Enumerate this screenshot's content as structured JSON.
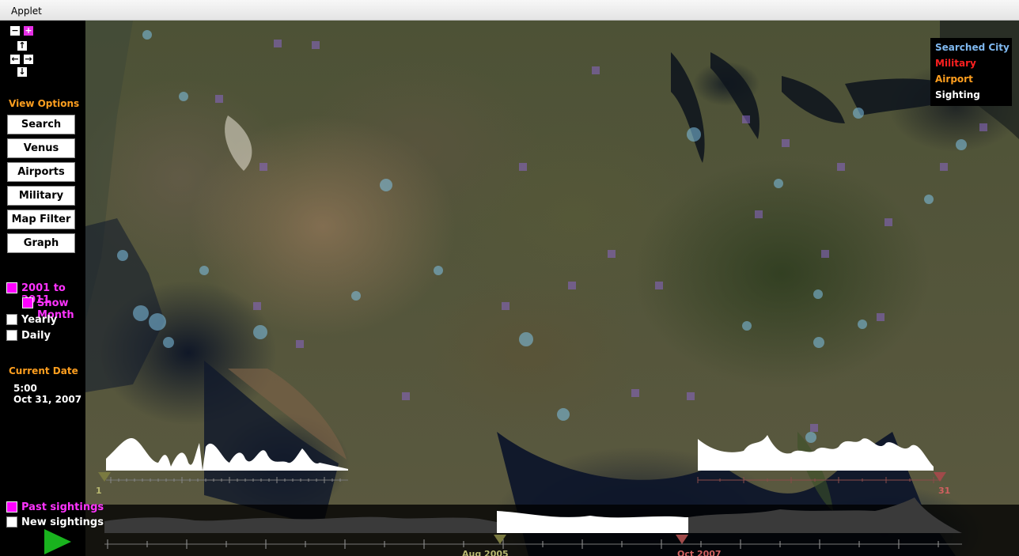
{
  "window": {
    "title": "Applet"
  },
  "nav": {
    "zoom_out": "−",
    "zoom_in": "+",
    "up": "↑",
    "left": "←",
    "right": "→",
    "down": "↓"
  },
  "view_options": {
    "title": "View Options",
    "buttons": [
      "Search",
      "Venus",
      "Airports",
      "Military",
      "Map Filter",
      "Graph"
    ]
  },
  "time_options": {
    "range_label": "2001 to 2011",
    "show_month": "Show Month",
    "yearly": "Yearly",
    "daily": "Daily"
  },
  "current_date": {
    "title": "Current Date",
    "time": "5:00",
    "date": "Oct 31, 2007"
  },
  "legend": {
    "items": [
      {
        "label": "Searched City",
        "color": "#7fb8f0"
      },
      {
        "label": "Military",
        "color": "#ff2020"
      },
      {
        "label": "Airport",
        "color": "#ff9f1f"
      },
      {
        "label": "Sighting",
        "color": "#ffffff"
      }
    ]
  },
  "month_timeline": {
    "start_label": "1",
    "end_label": "31"
  },
  "sightings_toggle": {
    "past": "Past sightings",
    "new": "New sightings"
  },
  "year_timeline": {
    "left_label": "Aug 2005",
    "right_label": "Oct 2007"
  },
  "colors": {
    "accent": "#ff33ff",
    "header_orange": "#ff9f1f",
    "play_green": "#19b31e"
  }
}
